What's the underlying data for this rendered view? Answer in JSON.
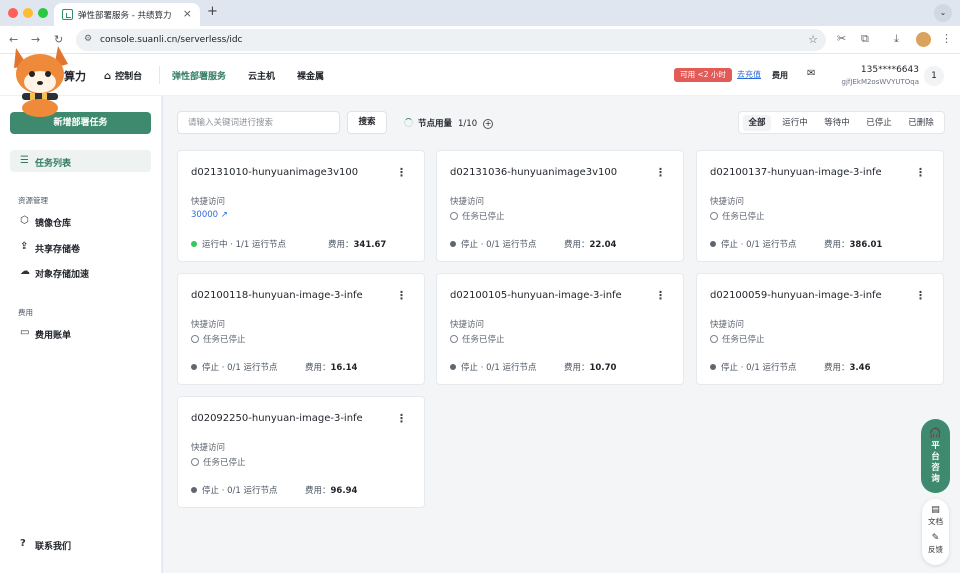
{
  "browser": {
    "tab_title": "弹性部署服务 - 共绩算力",
    "url": "console.suanli.cn/serverless/idc"
  },
  "header": {
    "brand": "算力",
    "home": "控制台",
    "nav": [
      "弹性部署服务",
      "云主机",
      "裸金属"
    ],
    "availability": "可用 <2 小时",
    "recharge": "去充值",
    "fee": "费用",
    "phone": "135****6643",
    "user_id": "gjfJEkM2osWVYUTOqa",
    "notifications": "1"
  },
  "sidebar": {
    "new_task": "新增部署任务",
    "task_list": "任务列表",
    "group_resources": "资源管理",
    "resources": [
      "镜像仓库",
      "共享存储卷",
      "对象存储加速"
    ],
    "group_fees": "费用",
    "billing": "费用账单",
    "contact": "联系我们"
  },
  "toolbar": {
    "search_placeholder": "请输入关键词进行搜索",
    "search_button": "搜索",
    "usage_label": "节点用量",
    "usage_value": "1/10",
    "filters": [
      "全部",
      "运行中",
      "等待中",
      "已停止",
      "已删除"
    ]
  },
  "cards": [
    {
      "name": "d02131010-hunyuanimage3v100",
      "quick_access": "快捷访问",
      "link": "30000",
      "status": "运行中",
      "nodes": "1/1 运行节点",
      "fee_label": "费用：",
      "fee": "341.67"
    },
    {
      "name": "d02131036-hunyuanimage3v100",
      "quick_access": "快捷访问",
      "stopped": "任务已停止",
      "status": "停止",
      "nodes": "0/1 运行节点",
      "fee_label": "费用：",
      "fee": "22.04"
    },
    {
      "name": "d02100137-hunyuan-image-3-infe",
      "quick_access": "快捷访问",
      "stopped": "任务已停止",
      "status": "停止",
      "nodes": "0/1 运行节点",
      "fee_label": "费用：",
      "fee": "386.01"
    },
    {
      "name": "d02100118-hunyuan-image-3-infe",
      "quick_access": "快捷访问",
      "stopped": "任务已停止",
      "status": "停止",
      "nodes": "0/1 运行节点",
      "fee_label": "费用：",
      "fee": "16.14"
    },
    {
      "name": "d02100105-hunyuan-image-3-infe",
      "quick_access": "快捷访问",
      "stopped": "任务已停止",
      "status": "停止",
      "nodes": "0/1 运行节点",
      "fee_label": "费用：",
      "fee": "10.70"
    },
    {
      "name": "d02100059-hunyuan-image-3-infe",
      "quick_access": "快捷访问",
      "stopped": "任务已停止",
      "status": "停止",
      "nodes": "0/1 运行节点",
      "fee_label": "费用：",
      "fee": "3.46"
    },
    {
      "name": "d02092250-hunyuan-image-3-infe",
      "quick_access": "快捷访问",
      "stopped": "任务已停止",
      "status": "停止",
      "nodes": "0/1 运行节点",
      "fee_label": "费用：",
      "fee": "96.94"
    }
  ],
  "floating": {
    "support": "平台咨询",
    "docs": "文档",
    "feedback": "反馈"
  },
  "colors": {
    "accent": "#3d8a6f",
    "danger": "#e35b57",
    "link": "#2f6bd8",
    "running": "#34c759"
  }
}
